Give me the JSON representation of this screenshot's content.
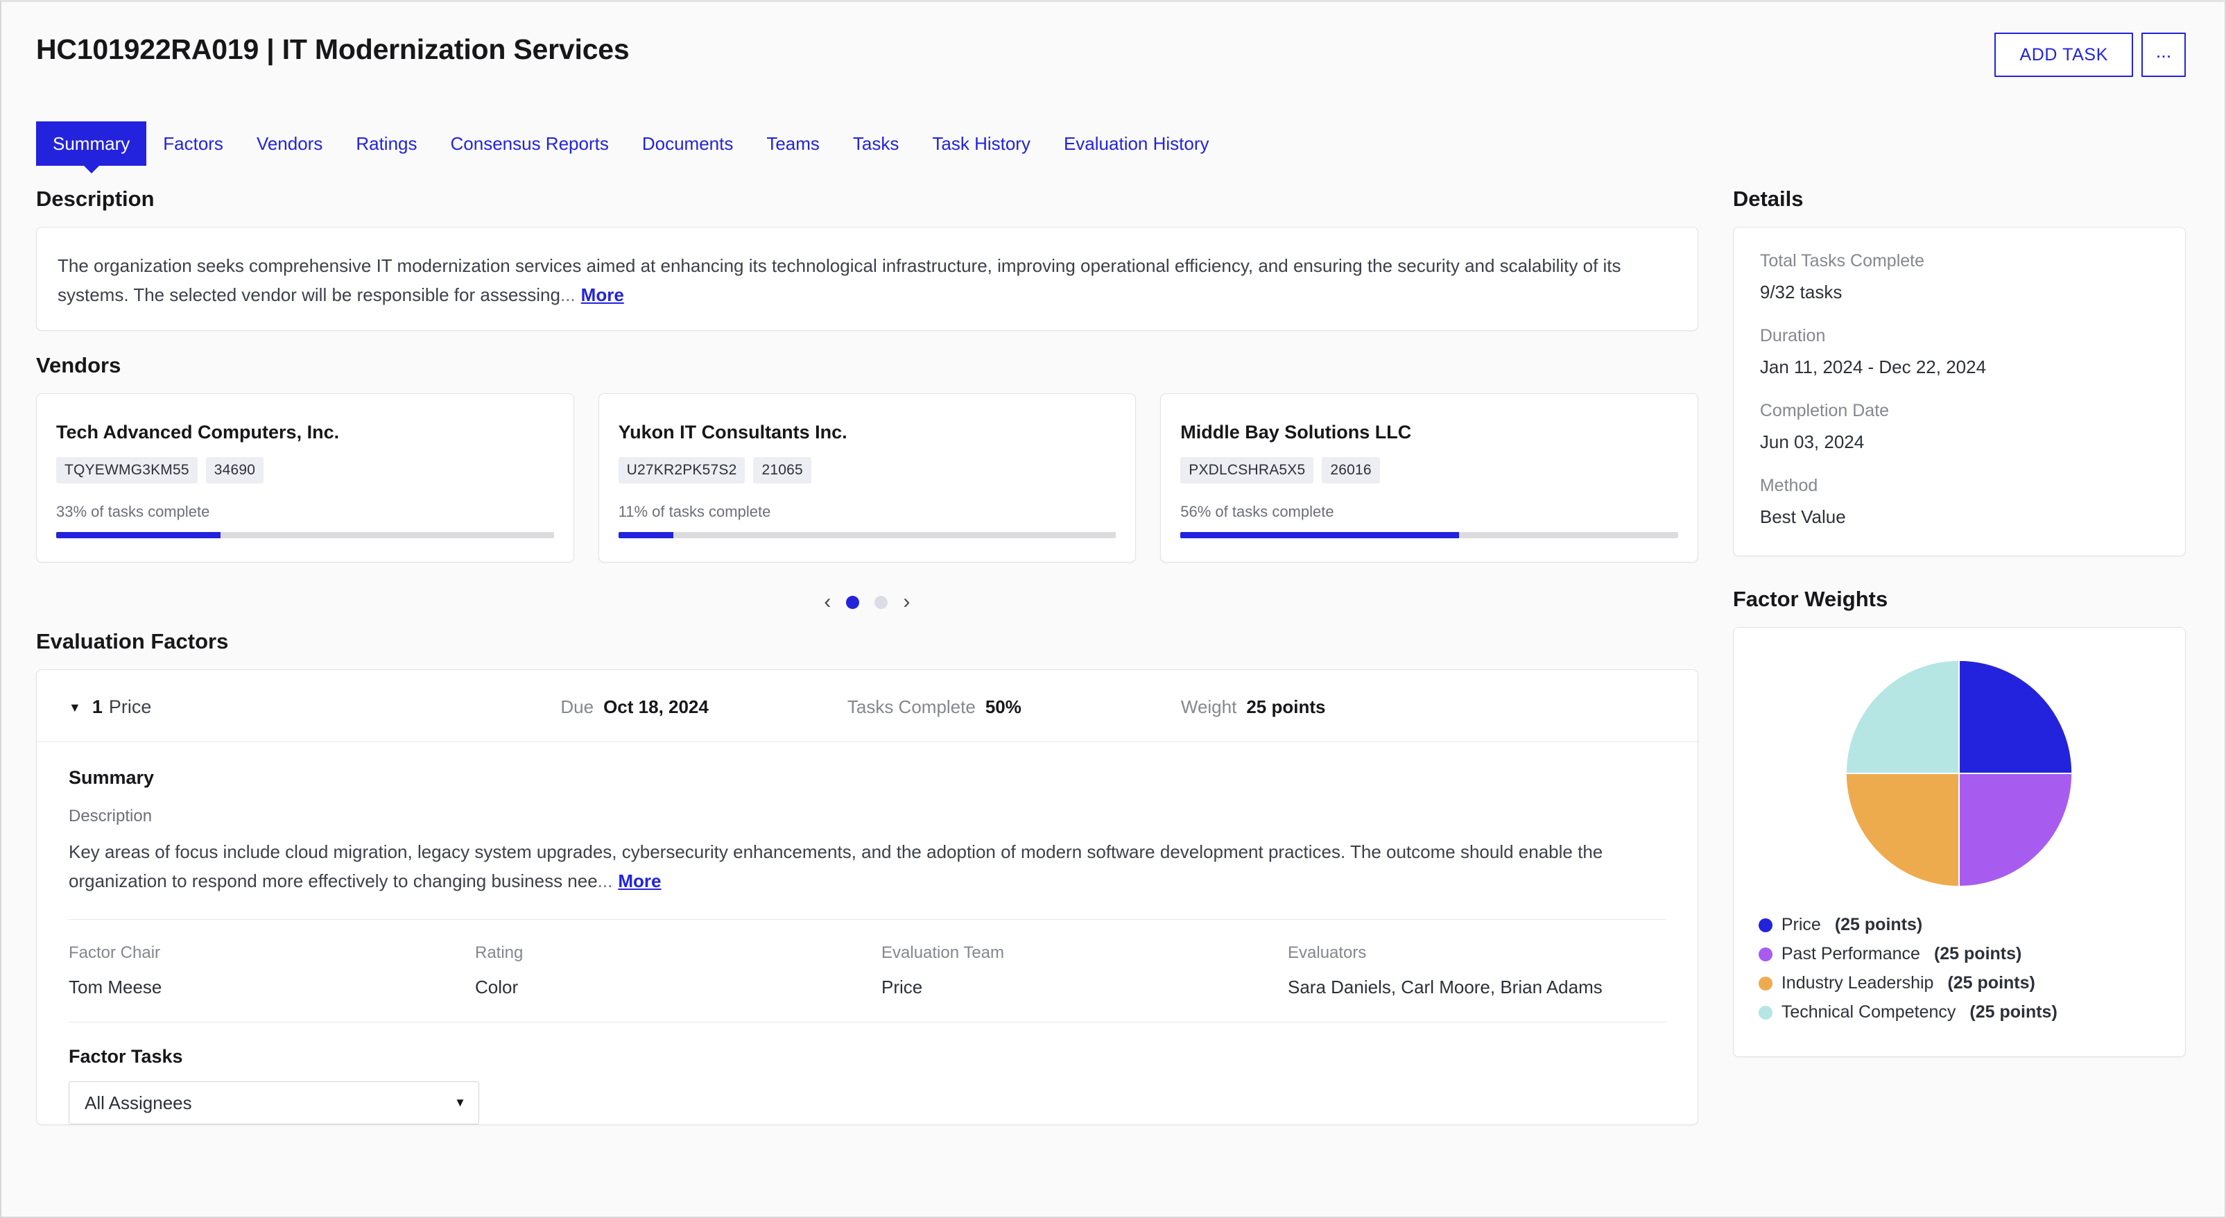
{
  "header": {
    "title": "HC101922RA019 | IT Modernization Services",
    "add_task_label": "ADD TASK",
    "more_actions_label": "..."
  },
  "tabs": [
    {
      "label": "Summary",
      "active": true
    },
    {
      "label": "Factors",
      "active": false
    },
    {
      "label": "Vendors",
      "active": false
    },
    {
      "label": "Ratings",
      "active": false
    },
    {
      "label": "Consensus Reports",
      "active": false
    },
    {
      "label": "Documents",
      "active": false
    },
    {
      "label": "Teams",
      "active": false
    },
    {
      "label": "Tasks",
      "active": false
    },
    {
      "label": "Task History",
      "active": false
    },
    {
      "label": "Evaluation History",
      "active": false
    }
  ],
  "description": {
    "heading": "Description",
    "text": "The organization seeks comprehensive IT modernization services aimed at enhancing its technological infrastructure, improving operational efficiency, and ensuring the security and scalability of its systems. The selected vendor will be responsible for assessing",
    "ellipsis": "...",
    "more_label": "More"
  },
  "vendors": {
    "heading": "Vendors",
    "items": [
      {
        "name": "Tech Advanced Computers, Inc.",
        "code": "TQYEWMG3KM55",
        "id": "34690",
        "progress_label": "33% of tasks complete",
        "progress_pct": 33
      },
      {
        "name": "Yukon IT Consultants Inc.",
        "code": "U27KR2PK57S2",
        "id": "21065",
        "progress_label": "11% of tasks complete",
        "progress_pct": 11
      },
      {
        "name": "Middle Bay Solutions LLC",
        "code": "PXDLCSHRA5X5",
        "id": "26016",
        "progress_label": "56% of tasks complete",
        "progress_pct": 56
      }
    ],
    "carousel": {
      "prev_label": "‹",
      "next_label": "›",
      "page_count": 2,
      "active_page": 1
    }
  },
  "evaluation_factors": {
    "heading": "Evaluation Factors",
    "factor": {
      "number": "1",
      "name": "Price",
      "caret": "▼",
      "due_label": "Due",
      "due_value": "Oct 18, 2024",
      "tasks_complete_label": "Tasks Complete",
      "tasks_complete_value": "50%",
      "weight_label": "Weight",
      "weight_value": "25 points",
      "summary_heading": "Summary",
      "description_label": "Description",
      "description_text": "Key areas of focus include cloud migration, legacy system upgrades, cybersecurity enhancements, and the adoption of modern software development practices. The outcome should enable the organization to respond more effectively to changing business nee",
      "ellipsis": "...",
      "more_label": "More",
      "fields": [
        {
          "label": "Factor Chair",
          "value": "Tom Meese"
        },
        {
          "label": "Rating",
          "value": "Color"
        },
        {
          "label": "Evaluation Team",
          "value": "Price"
        },
        {
          "label": "Evaluators",
          "value": "Sara Daniels, Carl Moore, Brian Adams"
        }
      ],
      "tasks_heading": "Factor Tasks",
      "assignee_filter_value": "All Assignees",
      "assignee_filter_caret": "▼"
    }
  },
  "details": {
    "heading": "Details",
    "items": [
      {
        "label": "Total Tasks Complete",
        "value": "9/32 tasks"
      },
      {
        "label": "Duration",
        "value": "Jan 11, 2024 - Dec 22, 2024"
      },
      {
        "label": "Completion Date",
        "value": "Jun 03, 2024"
      },
      {
        "label": "Method",
        "value": "Best Value"
      }
    ]
  },
  "factor_weights": {
    "heading": "Factor Weights"
  },
  "chart_data": {
    "type": "pie",
    "title": "Factor Weights",
    "categories": [
      "Price",
      "Past Performance",
      "Industry Leadership",
      "Technical Competency"
    ],
    "values": [
      25,
      25,
      25,
      25
    ],
    "unit": "points",
    "colors": [
      "#2323dd",
      "#a85cef",
      "#eeab4e",
      "#b5e6e4"
    ],
    "legend_position": "bottom",
    "legend": [
      {
        "name": "Price",
        "value_label": "(25 points)",
        "color": "#2323dd"
      },
      {
        "name": "Past Performance",
        "value_label": "(25 points)",
        "color": "#a85cef"
      },
      {
        "name": "Industry Leadership",
        "value_label": "(25 points)",
        "color": "#eeab4e"
      },
      {
        "name": "Technical Competency",
        "value_label": "(25 points)",
        "color": "#b5e6e4"
      }
    ]
  },
  "theme": {
    "accent": "#2323dd",
    "page_bg": "#fafafa",
    "card_bg": "#ffffff"
  }
}
